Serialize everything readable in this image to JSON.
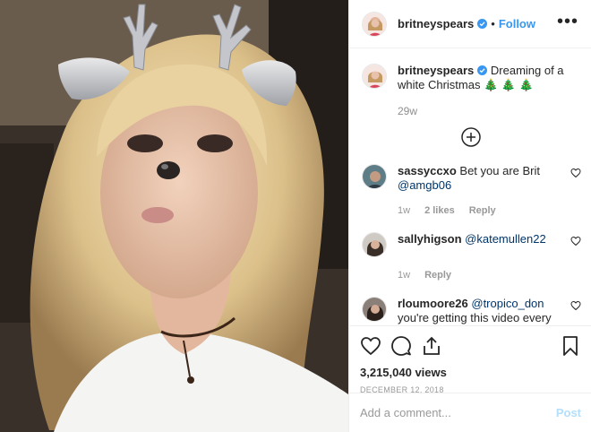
{
  "post": {
    "username": "britneyspears",
    "follow_label": "Follow",
    "separator": "•",
    "more_label": "•••"
  },
  "caption": {
    "username": "britneyspears",
    "text": "Dreaming of a white Christmas 🎄 🎄 🎄",
    "time": "29w"
  },
  "comments": [
    {
      "username": "sassyccxo",
      "text_before": "Bet you are Brit",
      "mention": "@amgb06",
      "text_after": "",
      "time": "1w",
      "likes": "2 likes",
      "reply": "Reply"
    },
    {
      "username": "sallyhigson",
      "text_before": "",
      "mention": "@katemullen22",
      "text_after": "",
      "time": "1w",
      "likes": "",
      "reply": "Reply"
    },
    {
      "username": "rloumoore26",
      "text_before": "",
      "mention": "@tropico_don",
      "text_after": "you're getting this video every Christmas x",
      "time": "",
      "likes": "",
      "reply": ""
    }
  ],
  "stats": {
    "views": "3,215,040 views",
    "date": "DECEMBER 12, 2018"
  },
  "composer": {
    "placeholder": "Add a comment...",
    "post_label": "Post"
  },
  "colors": {
    "accent": "#3897f0",
    "mention": "#003569",
    "post_disabled": "#b2dffc",
    "verified": "#3897f0"
  },
  "icons": [
    "verified-badge-icon",
    "more-options-icon",
    "load-more-icon",
    "heart-icon",
    "comment-icon",
    "share-icon",
    "bookmark-icon"
  ]
}
